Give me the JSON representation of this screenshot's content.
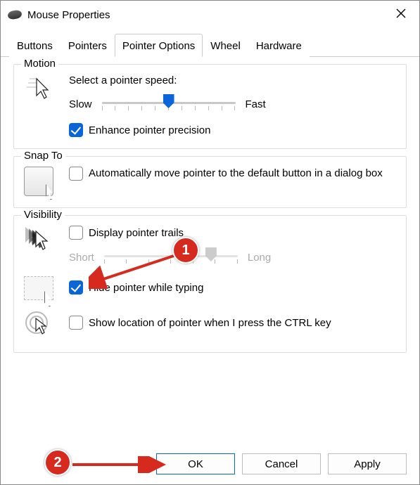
{
  "window": {
    "title": "Mouse Properties"
  },
  "tabs": {
    "items": [
      "Buttons",
      "Pointers",
      "Pointer Options",
      "Wheel",
      "Hardware"
    ],
    "active": 2
  },
  "motion": {
    "group_label": "Motion",
    "speed_label": "Select a pointer speed:",
    "slow": "Slow",
    "fast": "Fast",
    "slider_pos_pct": 50,
    "enhance_checked": true,
    "enhance_label": "Enhance pointer precision"
  },
  "snap": {
    "group_label": "Snap To",
    "auto_checked": false,
    "auto_label": "Automatically move pointer to the default button in a dialog box"
  },
  "visibility": {
    "group_label": "Visibility",
    "trails_checked": false,
    "trails_label": "Display pointer trails",
    "trails_short": "Short",
    "trails_long": "Long",
    "trails_slider_pos_pct": 80,
    "hide_checked": true,
    "hide_label": "Hide pointer while typing",
    "ctrl_checked": false,
    "ctrl_label": "Show location of pointer when I press the CTRL key"
  },
  "buttons": {
    "ok": "OK",
    "cancel": "Cancel",
    "apply": "Apply"
  },
  "annotations": {
    "n1": "1",
    "n2": "2"
  }
}
